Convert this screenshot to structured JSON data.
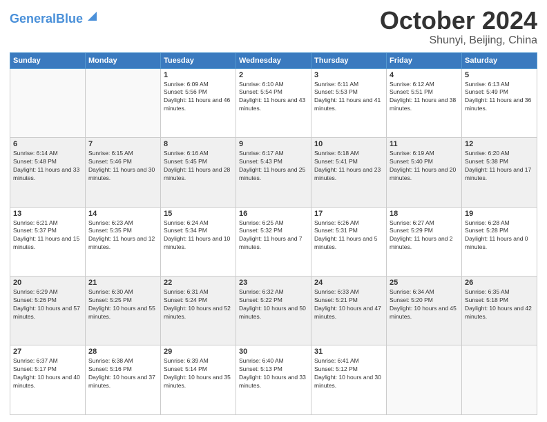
{
  "header": {
    "logo_general": "General",
    "logo_blue": "Blue",
    "month": "October 2024",
    "location": "Shunyi, Beijing, China"
  },
  "weekdays": [
    "Sunday",
    "Monday",
    "Tuesday",
    "Wednesday",
    "Thursday",
    "Friday",
    "Saturday"
  ],
  "weeks": [
    [
      {
        "day": "",
        "info": ""
      },
      {
        "day": "",
        "info": ""
      },
      {
        "day": "1",
        "info": "Sunrise: 6:09 AM\nSunset: 5:56 PM\nDaylight: 11 hours and 46 minutes."
      },
      {
        "day": "2",
        "info": "Sunrise: 6:10 AM\nSunset: 5:54 PM\nDaylight: 11 hours and 43 minutes."
      },
      {
        "day": "3",
        "info": "Sunrise: 6:11 AM\nSunset: 5:53 PM\nDaylight: 11 hours and 41 minutes."
      },
      {
        "day": "4",
        "info": "Sunrise: 6:12 AM\nSunset: 5:51 PM\nDaylight: 11 hours and 38 minutes."
      },
      {
        "day": "5",
        "info": "Sunrise: 6:13 AM\nSunset: 5:49 PM\nDaylight: 11 hours and 36 minutes."
      }
    ],
    [
      {
        "day": "6",
        "info": "Sunrise: 6:14 AM\nSunset: 5:48 PM\nDaylight: 11 hours and 33 minutes."
      },
      {
        "day": "7",
        "info": "Sunrise: 6:15 AM\nSunset: 5:46 PM\nDaylight: 11 hours and 30 minutes."
      },
      {
        "day": "8",
        "info": "Sunrise: 6:16 AM\nSunset: 5:45 PM\nDaylight: 11 hours and 28 minutes."
      },
      {
        "day": "9",
        "info": "Sunrise: 6:17 AM\nSunset: 5:43 PM\nDaylight: 11 hours and 25 minutes."
      },
      {
        "day": "10",
        "info": "Sunrise: 6:18 AM\nSunset: 5:41 PM\nDaylight: 11 hours and 23 minutes."
      },
      {
        "day": "11",
        "info": "Sunrise: 6:19 AM\nSunset: 5:40 PM\nDaylight: 11 hours and 20 minutes."
      },
      {
        "day": "12",
        "info": "Sunrise: 6:20 AM\nSunset: 5:38 PM\nDaylight: 11 hours and 17 minutes."
      }
    ],
    [
      {
        "day": "13",
        "info": "Sunrise: 6:21 AM\nSunset: 5:37 PM\nDaylight: 11 hours and 15 minutes."
      },
      {
        "day": "14",
        "info": "Sunrise: 6:23 AM\nSunset: 5:35 PM\nDaylight: 11 hours and 12 minutes."
      },
      {
        "day": "15",
        "info": "Sunrise: 6:24 AM\nSunset: 5:34 PM\nDaylight: 11 hours and 10 minutes."
      },
      {
        "day": "16",
        "info": "Sunrise: 6:25 AM\nSunset: 5:32 PM\nDaylight: 11 hours and 7 minutes."
      },
      {
        "day": "17",
        "info": "Sunrise: 6:26 AM\nSunset: 5:31 PM\nDaylight: 11 hours and 5 minutes."
      },
      {
        "day": "18",
        "info": "Sunrise: 6:27 AM\nSunset: 5:29 PM\nDaylight: 11 hours and 2 minutes."
      },
      {
        "day": "19",
        "info": "Sunrise: 6:28 AM\nSunset: 5:28 PM\nDaylight: 11 hours and 0 minutes."
      }
    ],
    [
      {
        "day": "20",
        "info": "Sunrise: 6:29 AM\nSunset: 5:26 PM\nDaylight: 10 hours and 57 minutes."
      },
      {
        "day": "21",
        "info": "Sunrise: 6:30 AM\nSunset: 5:25 PM\nDaylight: 10 hours and 55 minutes."
      },
      {
        "day": "22",
        "info": "Sunrise: 6:31 AM\nSunset: 5:24 PM\nDaylight: 10 hours and 52 minutes."
      },
      {
        "day": "23",
        "info": "Sunrise: 6:32 AM\nSunset: 5:22 PM\nDaylight: 10 hours and 50 minutes."
      },
      {
        "day": "24",
        "info": "Sunrise: 6:33 AM\nSunset: 5:21 PM\nDaylight: 10 hours and 47 minutes."
      },
      {
        "day": "25",
        "info": "Sunrise: 6:34 AM\nSunset: 5:20 PM\nDaylight: 10 hours and 45 minutes."
      },
      {
        "day": "26",
        "info": "Sunrise: 6:35 AM\nSunset: 5:18 PM\nDaylight: 10 hours and 42 minutes."
      }
    ],
    [
      {
        "day": "27",
        "info": "Sunrise: 6:37 AM\nSunset: 5:17 PM\nDaylight: 10 hours and 40 minutes."
      },
      {
        "day": "28",
        "info": "Sunrise: 6:38 AM\nSunset: 5:16 PM\nDaylight: 10 hours and 37 minutes."
      },
      {
        "day": "29",
        "info": "Sunrise: 6:39 AM\nSunset: 5:14 PM\nDaylight: 10 hours and 35 minutes."
      },
      {
        "day": "30",
        "info": "Sunrise: 6:40 AM\nSunset: 5:13 PM\nDaylight: 10 hours and 33 minutes."
      },
      {
        "day": "31",
        "info": "Sunrise: 6:41 AM\nSunset: 5:12 PM\nDaylight: 10 hours and 30 minutes."
      },
      {
        "day": "",
        "info": ""
      },
      {
        "day": "",
        "info": ""
      }
    ]
  ]
}
